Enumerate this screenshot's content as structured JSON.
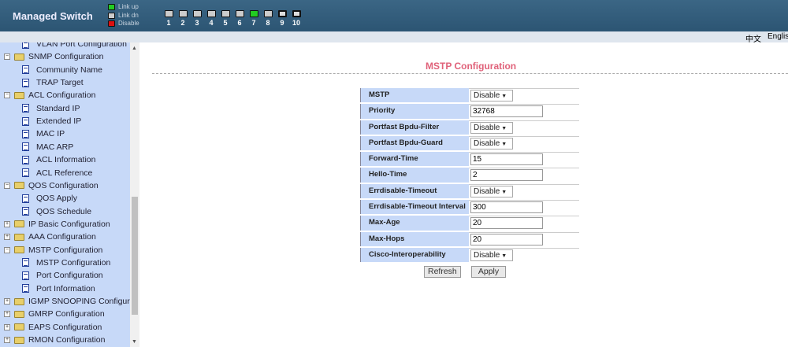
{
  "header": {
    "title": "Managed Switch",
    "legend": [
      {
        "label": "Link up",
        "color": "#22cc22"
      },
      {
        "label": "Link dn",
        "color": "#cccccc"
      },
      {
        "label": "Disable",
        "color": "#dd1111"
      }
    ],
    "ports": [
      {
        "n": "1",
        "state": "down"
      },
      {
        "n": "2",
        "state": "down"
      },
      {
        "n": "3",
        "state": "down"
      },
      {
        "n": "4",
        "state": "down"
      },
      {
        "n": "5",
        "state": "down"
      },
      {
        "n": "6",
        "state": "down"
      },
      {
        "n": "7",
        "state": "up"
      },
      {
        "n": "8",
        "state": "down"
      },
      {
        "n": "9",
        "state": "combo"
      },
      {
        "n": "10",
        "state": "combo"
      }
    ]
  },
  "lang": {
    "chinese": "中文",
    "english": "English"
  },
  "sidebar": {
    "items": [
      {
        "label": "VLAN Port Configuration",
        "type": "doc",
        "level": 1
      },
      {
        "label": "SNMP Configuration",
        "type": "folder",
        "level": 0,
        "expanded": true
      },
      {
        "label": "Community Name",
        "type": "doc",
        "level": 1
      },
      {
        "label": "TRAP Target",
        "type": "doc",
        "level": 1
      },
      {
        "label": "ACL Configuration",
        "type": "folder",
        "level": 0,
        "expanded": true
      },
      {
        "label": "Standard IP",
        "type": "doc",
        "level": 1
      },
      {
        "label": "Extended IP",
        "type": "doc",
        "level": 1
      },
      {
        "label": "MAC IP",
        "type": "doc",
        "level": 1
      },
      {
        "label": "MAC ARP",
        "type": "doc",
        "level": 1
      },
      {
        "label": "ACL Information",
        "type": "doc",
        "level": 1
      },
      {
        "label": "ACL Reference",
        "type": "doc",
        "level": 1
      },
      {
        "label": "QOS Configuration",
        "type": "folder",
        "level": 0,
        "expanded": true
      },
      {
        "label": "QOS Apply",
        "type": "doc",
        "level": 1
      },
      {
        "label": "QOS Schedule",
        "type": "doc",
        "level": 1
      },
      {
        "label": "IP Basic Configuration",
        "type": "folder",
        "level": 0,
        "expanded": false
      },
      {
        "label": "AAA Configuration",
        "type": "folder",
        "level": 0,
        "expanded": false
      },
      {
        "label": "MSTP Configuration",
        "type": "folder",
        "level": 0,
        "expanded": true
      },
      {
        "label": "MSTP Configuration",
        "type": "doc",
        "level": 1
      },
      {
        "label": "Port Configuration",
        "type": "doc",
        "level": 1
      },
      {
        "label": "Port Information",
        "type": "doc",
        "level": 1
      },
      {
        "label": "IGMP SNOOPING Configuration",
        "type": "folder",
        "level": 0,
        "expanded": false
      },
      {
        "label": "GMRP Configuration",
        "type": "folder",
        "level": 0,
        "expanded": false
      },
      {
        "label": "EAPS Configuration",
        "type": "folder",
        "level": 0,
        "expanded": false
      },
      {
        "label": "RMON Configuration",
        "type": "folder",
        "level": 0,
        "expanded": false
      }
    ]
  },
  "main": {
    "title": "MSTP Configuration",
    "fields": [
      {
        "label": "MSTP",
        "kind": "select",
        "value": "Disable"
      },
      {
        "label": "Priority",
        "kind": "input",
        "value": "32768"
      },
      {
        "label": "Portfast Bpdu-Filter",
        "kind": "select",
        "value": "Disable"
      },
      {
        "label": "Portfast Bpdu-Guard",
        "kind": "select",
        "value": "Disable"
      },
      {
        "label": "Forward-Time",
        "kind": "input",
        "value": "15"
      },
      {
        "label": "Hello-Time",
        "kind": "input",
        "value": "2"
      },
      {
        "label": "Errdisable-Timeout",
        "kind": "select",
        "value": "Disable"
      },
      {
        "label": "Errdisable-Timeout Interval",
        "kind": "input",
        "value": "300"
      },
      {
        "label": "Max-Age",
        "kind": "input",
        "value": "20"
      },
      {
        "label": "Max-Hops",
        "kind": "input",
        "value": "20"
      },
      {
        "label": "Cisco-Interoperability",
        "kind": "select",
        "value": "Disable"
      }
    ],
    "refresh_label": "Refresh",
    "apply_label": "Apply"
  }
}
